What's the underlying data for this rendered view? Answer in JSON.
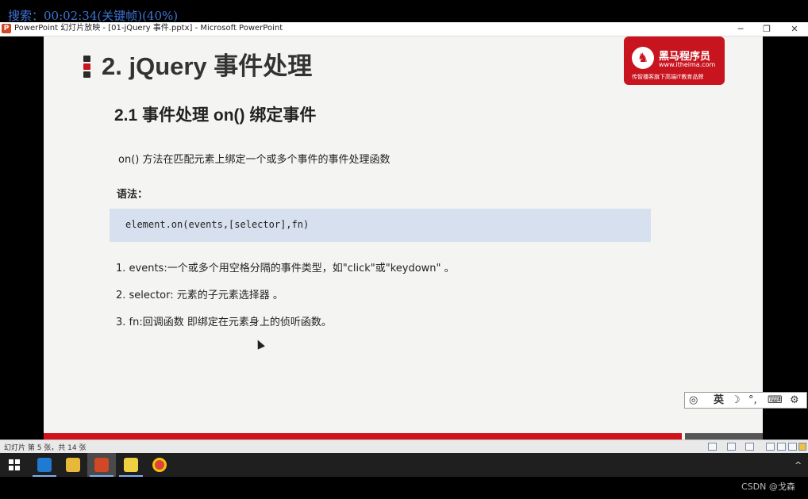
{
  "overlay": {
    "search_text": "搜索：00:02:34(关键帧)(40%)"
  },
  "window": {
    "title": "PowerPoint 幻灯片放映 - [01-jQuery 事件.pptx] - Microsoft PowerPoint",
    "minimize": "─",
    "restore": "❐",
    "close": "✕"
  },
  "slide": {
    "heading": "2. jQuery 事件处理",
    "logo": {
      "name": "黑马程序员",
      "url": "www.itheima.com",
      "slogan": "传智播客旗下高端IT教育品牌"
    },
    "subheading": "2.1 事件处理 on() 绑定事件",
    "description": "on() 方法在匹配元素上绑定一个或多个事件的事件处理函数",
    "syntax_label": "语法：",
    "code": "element.on(events,[selector],fn)",
    "items": [
      "1. events:一个或多个用空格分隔的事件类型，如\"click\"或\"keydown\" 。",
      "2. selector: 元素的子元素选择器 。",
      "3. fn:回调函数 即绑定在元素身上的侦听函数。"
    ]
  },
  "ime_bar": {
    "lang": "英",
    "moon": "☽",
    "punct": "°,",
    "keyboard": "⌨",
    "settings": "⚙"
  },
  "statusbar": {
    "slide_info": "幻灯片 第 5 张，共 14 张"
  },
  "taskbar": {
    "start_icon": "windows-icon"
  },
  "watermark": "CSDN @戈森",
  "colors": {
    "brand_red": "#c8141e",
    "code_bg": "#d7e0ee",
    "slide_bg": "#f4f4f2"
  }
}
